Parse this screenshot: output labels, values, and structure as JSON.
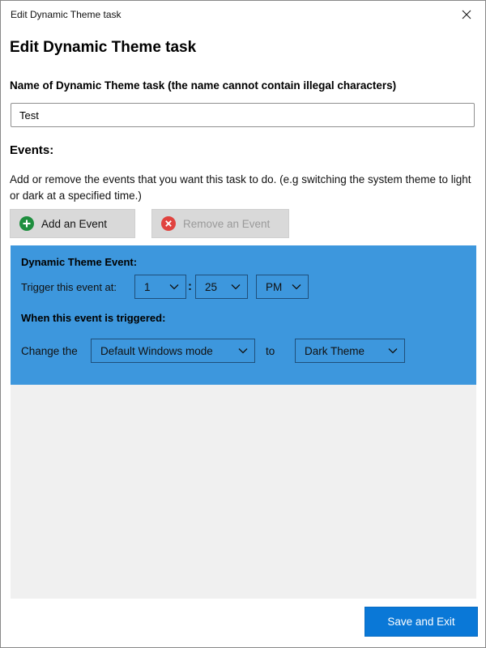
{
  "window": {
    "title": "Edit Dynamic Theme task",
    "close_icon": "close-icon"
  },
  "page": {
    "heading": "Edit Dynamic Theme task",
    "name_label": "Name of Dynamic Theme task (the name cannot contain illegal characters)",
    "name_value": "Test",
    "events_label": "Events:",
    "events_description": "Add or remove the events that you want this task to do. (e.g switching the system theme to light or dark at a specified time.)"
  },
  "buttons": {
    "add_event": {
      "label": "Add an Event",
      "icon": "plus-circle-icon",
      "enabled": true
    },
    "remove_event": {
      "label": "Remove an Event",
      "icon": "x-circle-icon",
      "enabled": false
    },
    "save_exit": "Save and Exit"
  },
  "event": {
    "title": "Dynamic Theme Event:",
    "trigger_label": "Trigger this event at:",
    "hour": "1",
    "separator": ":",
    "minute": "25",
    "period": "PM",
    "when_label": "When this event is triggered:",
    "change_label": "Change the",
    "target": "Default Windows mode",
    "to_label": "to",
    "theme": "Dark Theme"
  },
  "colors": {
    "event_card": "#3d97dd",
    "primary_button": "#0a78d7",
    "add_icon": "#1e8e3e",
    "remove_icon": "#e0433f"
  }
}
